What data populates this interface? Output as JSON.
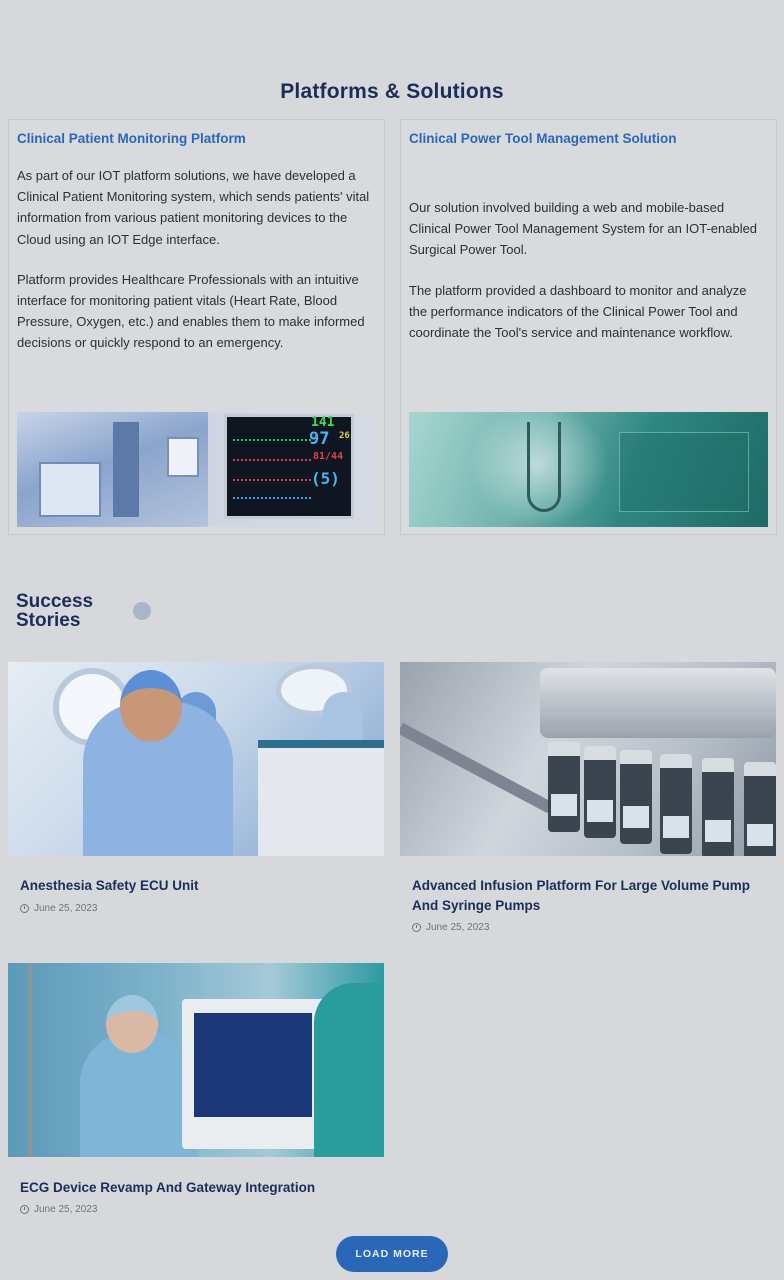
{
  "section_title": "Platforms & Solutions",
  "platforms": [
    {
      "title": "Clinical Patient Monitoring Platform",
      "paragraphs": [
        "As part of our IOT platform solutions, we have developed a Clinical Patient Monitoring system, which sends patients' vital information from various patient monitoring devices to the Cloud using an IOT Edge interface.",
        "Platform provides Healthcare Professionals with an intuitive interface for monitoring patient vitals (Heart Rate, Blood Pressure, Oxygen, etc.) and enables them to make informed decisions or quickly respond to an emergency."
      ],
      "monitor_readings": {
        "hr": "141",
        "spo2": "97",
        "bp": "81/44",
        "rr": "(5)",
        "temp": "26"
      }
    },
    {
      "title": "Clinical Power Tool Management Solution",
      "paragraphs": [
        "Our solution involved building a web and mobile-based Clinical Power Tool Management System for an IOT-enabled Surgical Power Tool.",
        "The platform provided a dashboard to monitor and analyze the performance indicators of the Clinical Power Tool and coordinate the Tool's service and maintenance workflow."
      ]
    }
  ],
  "success_title_line1": "Success",
  "success_title_line2": "Stories",
  "stories": [
    {
      "title": "Anesthesia Safety ECU Unit",
      "date": "June 25, 2023"
    },
    {
      "title": "Advanced Infusion Platform For Large Volume Pump And Syringe Pumps",
      "date": "June 25, 2023"
    },
    {
      "title": "ECG Device Revamp And Gateway Integration",
      "date": "June 25, 2023"
    }
  ],
  "load_more_label": "LOAD MORE",
  "colors": {
    "accent": "#2a67b8",
    "heading": "#1c2d5a",
    "background": "#d7d8dc"
  }
}
